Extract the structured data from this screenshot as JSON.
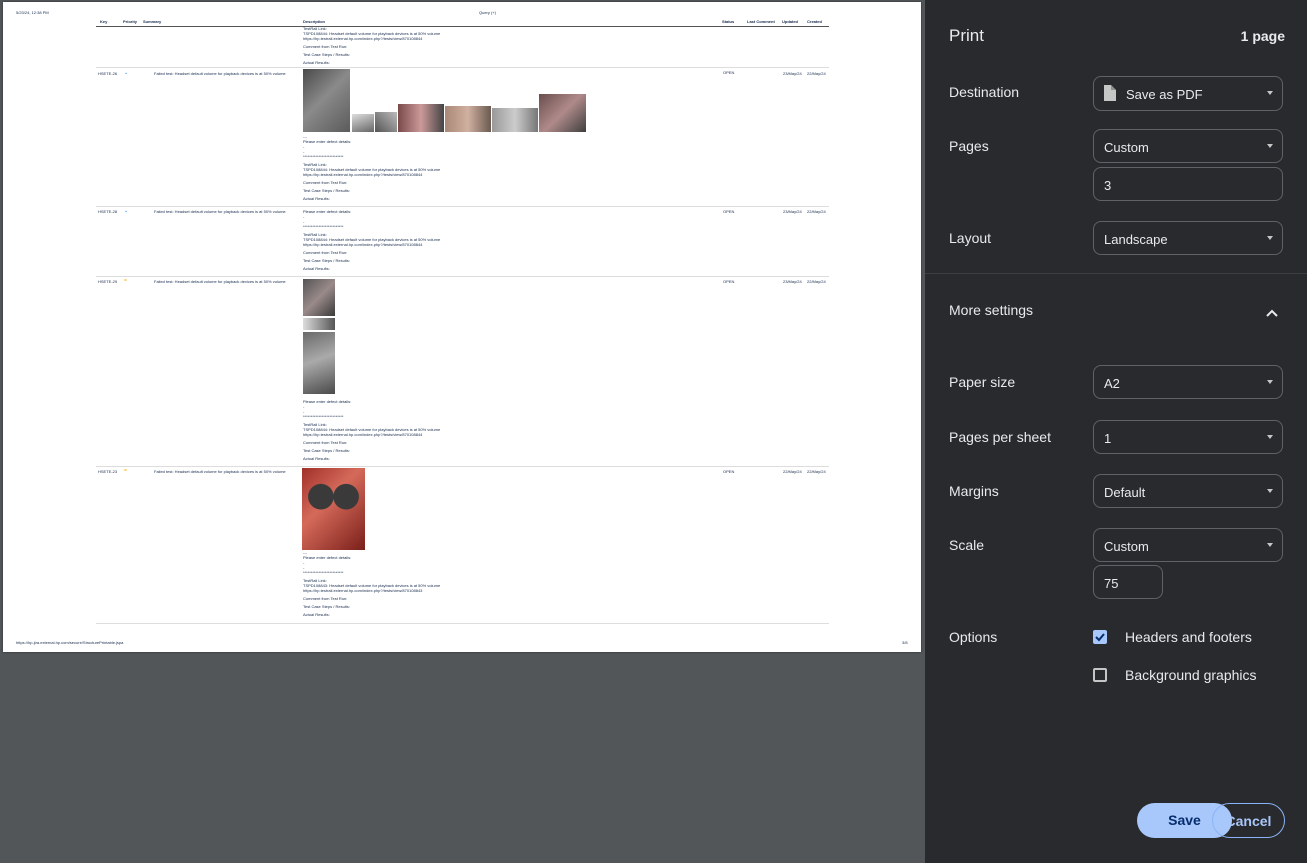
{
  "preview": {
    "date": "5/23/24, 12:38 PM",
    "title": "Query (+)",
    "url": "https://hp-jira.external.hp.com/secure/StructurePrintable.jspa",
    "page": "3/8",
    "columns": [
      "Key",
      "Priority",
      "Summary",
      "Description",
      "Status",
      "Last Comment",
      "Updated",
      "Created"
    ],
    "top_block": [
      "TestRail Link:",
      "TSPD108844: Headset default volume for playback devices is at 50% volume",
      "https://hp.testrail.external.hp.com/index.php?/tests/view/870108844",
      "Comment from Test Run:",
      "Test Case Steps / Results:",
      "Actual Results:"
    ],
    "rows": [
      {
        "key": "HSETE-26",
        "summary": "Failed test: Headset default volume for playback devices is at 50% volume",
        "status": "OPEN",
        "updated": "23/May/24",
        "created": "22/May/24",
        "desc": [
          "---",
          "Please enter defect details:",
          "-",
          "-",
          "**************************",
          "TestRail Link:",
          "TSPD108844: Headset default volume for playback devices is at 50% volume",
          "https://hp.testrail.external.hp.com/index.php?/tests/view/870108844",
          "Comment from Test Run:",
          "Test Case Steps / Results:",
          "Actual Results:"
        ]
      },
      {
        "key": "HSETE-28",
        "summary": "Failed test: Headset default volume for playback devices is at 50% volume",
        "status": "OPEN",
        "updated": "23/May/24",
        "created": "22/May/24",
        "desc": [
          "Please enter defect details:",
          "-",
          "-",
          "**************************",
          "TestRail Link:",
          "TSPD108844: Headset default volume for playback devices is at 50% volume",
          "https://hp.testrail.external.hp.com/index.php?/tests/view/870108844",
          "Comment from Test Run:",
          "Test Case Steps / Results:",
          "Actual Results:"
        ]
      },
      {
        "key": "HSETE-29",
        "summary": "Failed test: Headset default volume for playback devices is at 50% volume",
        "status": "OPEN",
        "updated": "23/May/24",
        "created": "22/May/24",
        "desc": [
          "Please enter defect details:",
          "-",
          "-",
          "**************************",
          "TestRail Link:",
          "TSPD108844: Headset default volume for playback devices is at 50% volume",
          "https://hp.testrail.external.hp.com/index.php?/tests/view/870108844",
          "Comment from Test Run:",
          "Test Case Steps / Results:",
          "Actual Results:"
        ]
      },
      {
        "key": "HSETE-23",
        "summary": "Failed test: Headset default volume for playback devices is at 50% volume",
        "status": "OPEN",
        "updated": "22/May/24",
        "created": "22/May/24",
        "desc": [
          "---",
          "Please enter defect details:",
          "-",
          "-",
          "**************************",
          "TestRail Link:",
          "TSPD108843: Headset default volume for playback devices is at 50% volume",
          "https://hp.testrail.external.hp.com/index.php?/tests/view/870108843",
          "Comment from Test Run:",
          "Test Case Steps / Results:",
          "Actual Results:"
        ]
      }
    ]
  },
  "print": {
    "title": "Print",
    "sheet_count": "1 page",
    "destination_label": "Destination",
    "destination_value": "Save as PDF",
    "pages_label": "Pages",
    "pages_value": "Custom",
    "pages_range": "3",
    "layout_label": "Layout",
    "layout_value": "Landscape",
    "more_settings": "More settings",
    "paper_label": "Paper size",
    "paper_value": "A2",
    "pps_label": "Pages per sheet",
    "pps_value": "1",
    "margins_label": "Margins",
    "margins_value": "Default",
    "scale_label": "Scale",
    "scale_value": "Custom",
    "scale_percent": "75",
    "options_label": "Options",
    "headers_footers": "Headers and footers",
    "headers_footers_checked": true,
    "background_graphics": "Background graphics",
    "background_graphics_checked": false,
    "save_label": "Save",
    "cancel_label": "Cancel"
  },
  "colors": {
    "panel_bg": "#292a2d",
    "preview_bg": "#525659",
    "accent": "#a8c7fa"
  }
}
